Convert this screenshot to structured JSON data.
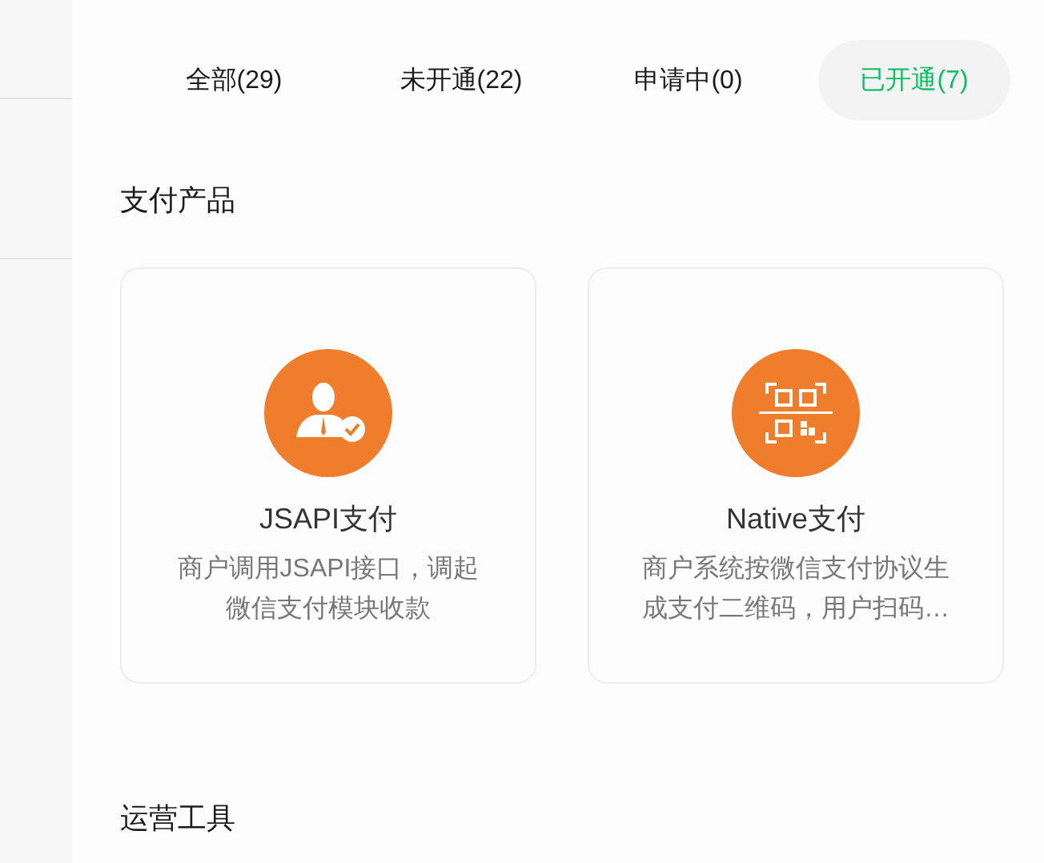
{
  "tabs": [
    {
      "label": "全部(29)",
      "selected": false
    },
    {
      "label": "未开通(22)",
      "selected": false
    },
    {
      "label": "申请中(0)",
      "selected": false
    },
    {
      "label": "已开通(7)",
      "selected": true
    }
  ],
  "sections": [
    {
      "title": "支付产品",
      "cards": [
        {
          "kind": "user",
          "title": "JSAPI支付",
          "description": "商户调用JSAPI接口，调起微信支付模块收款"
        },
        {
          "kind": "qr",
          "title": "Native支付",
          "description": "商户系统按微信支付协议生成支付二维码，用户扫码…"
        }
      ]
    },
    {
      "title": "运营工具"
    }
  ]
}
